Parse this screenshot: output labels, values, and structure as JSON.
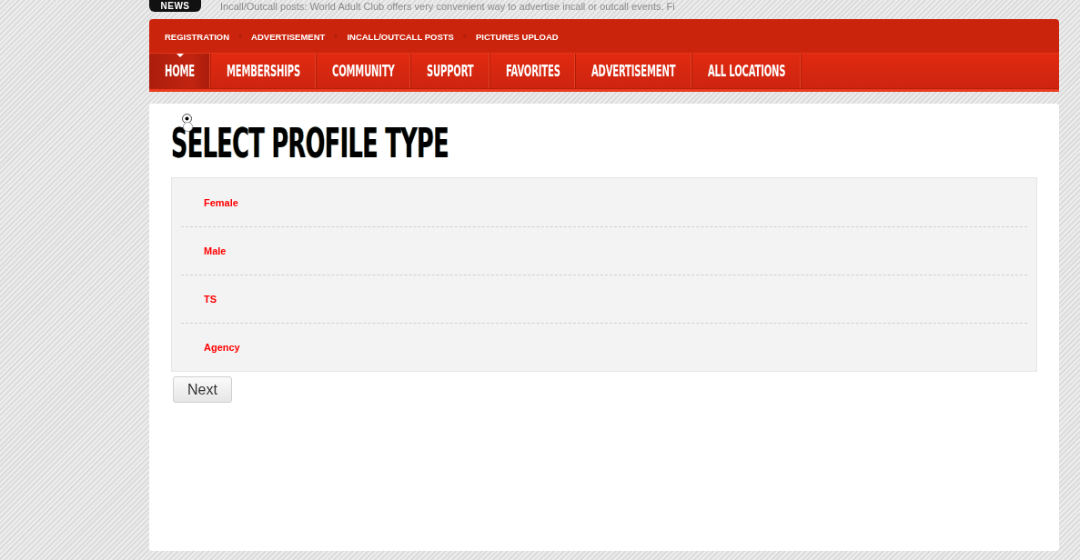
{
  "news": {
    "badge": "NEWS",
    "ticker": "Incall/Outcall posts: World Adult Club offers very convenient way to advertise incall or outcall events. Fi"
  },
  "top_menu": [
    "REGISTRATION",
    "ADVERTISEMENT",
    "INCALL/OUTCALL POSTS",
    "PICTURES UPLOAD"
  ],
  "main_nav": [
    {
      "label": "HOME",
      "selected": true
    },
    {
      "label": "MEMBERSHIPS",
      "selected": false
    },
    {
      "label": "COMMUNITY",
      "selected": false
    },
    {
      "label": "SUPPORT",
      "selected": false
    },
    {
      "label": "FAVORITES",
      "selected": false
    },
    {
      "label": "ADVERTISEMENT",
      "selected": false
    },
    {
      "label": "ALL LOCATIONS",
      "selected": false
    }
  ],
  "page": {
    "title": "SELECT PROFILE TYPE",
    "radio_buttons": [
      {
        "selected": true
      },
      {
        "selected": false
      }
    ],
    "options": [
      "Female",
      "Male",
      "TS",
      "Agency"
    ],
    "next_button": "Next"
  }
}
